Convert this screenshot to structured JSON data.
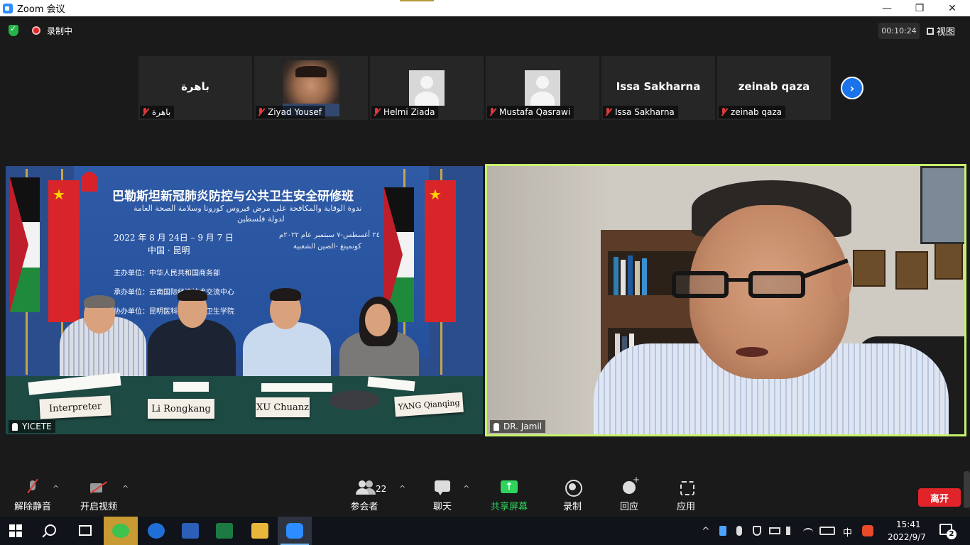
{
  "window": {
    "title": "Zoom 会议",
    "minimize_glyph": "—",
    "maximize_glyph": "❐",
    "close_glyph": "✕"
  },
  "topbar": {
    "recording_label": "录制中",
    "timer": "00:10:24",
    "view_label": "视图"
  },
  "thumbnails": [
    {
      "display": "باهرة",
      "name": "باهرة",
      "kind": "text"
    },
    {
      "display": "",
      "name": "Ziyad Yousef",
      "kind": "photo"
    },
    {
      "display": "",
      "name": "Helmi Ziada",
      "kind": "avatar"
    },
    {
      "display": "",
      "name": "Mustafa Qasrawi",
      "kind": "avatar"
    },
    {
      "display": "Issa Sakharna",
      "name": "Issa Sakharna",
      "kind": "text"
    },
    {
      "display": "zeinab qaza",
      "name": "zeinab qaza",
      "kind": "text"
    }
  ],
  "next_page_glyph": "›",
  "main_videos": {
    "left": {
      "name": "YICETE",
      "banner": {
        "title": "巴勒斯坦新冠肺炎防控与公共卫生安全研修班",
        "arabic_line1": "ندوة الوقاية والمكافحة على مرض فيروس كورونا وسلامة الصحة العامة",
        "arabic_line2": "لدولة فلسطين",
        "date": "2022 年 8 月 24日 – 9 月 7 日",
        "date_arabic": "٢٤ أغسطس-٧ سبتمبر عام ٢٠٢٢م",
        "city": "中国 · 昆明",
        "city_arabic": "كونمينغ -الصين الشعبية",
        "organizer": "主办单位：中华人民共和国商务部",
        "undertaker": "承办单位：云南国际经济技术交流中心",
        "co_organizer": "协办单位：昆明医科大学公共卫生学院"
      },
      "nameplates": [
        "Interpreter",
        "Li Rongkang",
        "XU Chuanz",
        "YANG Qianqing"
      ]
    },
    "right": {
      "name": "DR. Jamil"
    }
  },
  "toolbar": {
    "unmute": "解除静音",
    "start_video": "开启视频",
    "participants": "参会者",
    "participants_count": "22",
    "chat": "聊天",
    "share": "共享屏幕",
    "record": "录制",
    "reactions": "回应",
    "apps": "应用",
    "leave": "离开",
    "caret_glyph": "^"
  },
  "taskbar": {
    "time": "15:41",
    "date": "2022/9/7",
    "ime": "中",
    "notification_count": "2",
    "tray_chevron": "^"
  },
  "colors": {
    "active_speaker_border": "#c8f26d",
    "leave_red": "#e0242a",
    "share_green": "#2fd45d",
    "next_blue": "#1a73e8"
  }
}
